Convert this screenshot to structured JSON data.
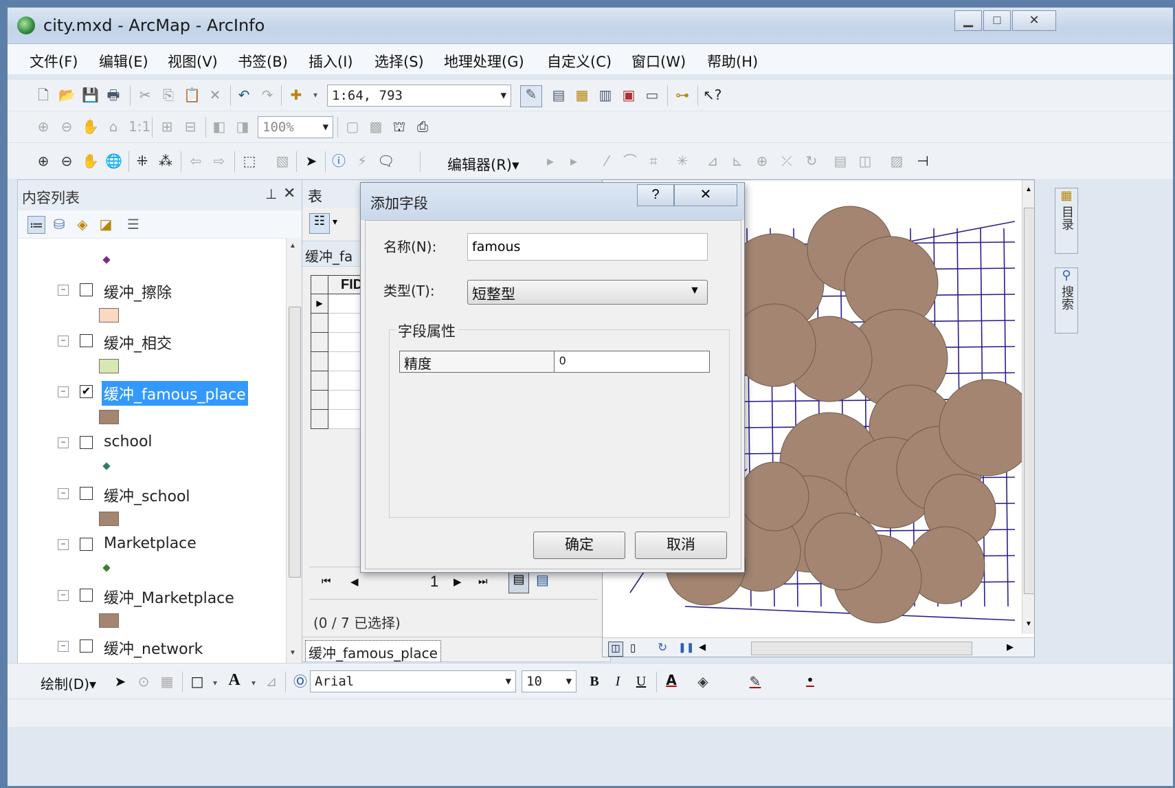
{
  "window": {
    "title": "city.mxd - ArcMap - ArcInfo",
    "minimize": "▭",
    "maximize": "□",
    "close": "✕"
  },
  "menu": [
    "文件(F)",
    "编辑(E)",
    "视图(V)",
    "书签(B)",
    "插入(I)",
    "选择(S)",
    "地理处理(G)",
    "自定义(C)",
    "窗口(W)",
    "帮助(H)"
  ],
  "toolbar": {
    "scale": "1:64, 793",
    "layout_zoom": "100%",
    "editor_label": "编辑器(R)▾"
  },
  "toc": {
    "title": "内容列表",
    "pin": "ᵖ",
    "close": "✕",
    "layers": [
      {
        "name": "缓冲_擦除",
        "checked": false,
        "symbol": "#f9d9c4"
      },
      {
        "name": "缓冲_相交",
        "checked": false,
        "symbol": "#d7e8b5"
      },
      {
        "name": "缓冲_famous_place",
        "checked": true,
        "symbol": "#a48571"
      },
      {
        "name": "school",
        "checked": false,
        "symbol": "#2f7a6b"
      },
      {
        "name": "缓冲_school",
        "checked": false,
        "symbol": "#a48571"
      },
      {
        "name": "Marketplace",
        "checked": false,
        "symbol": "#3c7a35"
      },
      {
        "name": "缓冲_Marketplace",
        "checked": false,
        "symbol": "#a48571"
      },
      {
        "name": "缓冲_network",
        "checked": false,
        "symbol": "#a48571"
      }
    ],
    "top_point_color": "#7b2c7c"
  },
  "table": {
    "title": "表",
    "tab": "缓冲_fa",
    "column": "FID",
    "record": "1",
    "selection": "(0 / 7 已选择)",
    "footer_tab": "缓冲_famous_place"
  },
  "dialog": {
    "title": "添加字段",
    "help": "?",
    "close": "✕",
    "name_label": "名称(N):",
    "name_value": "famous",
    "type_label": "类型(T):",
    "type_value": "短整型",
    "group_label": "字段属性",
    "prop_name": "精度",
    "prop_value": "0",
    "ok": "确定",
    "cancel": "取消"
  },
  "draw_toolbar": {
    "draw_label": "绘制(D)▾",
    "font": "Arial",
    "size": "10",
    "bold": "B",
    "italic": "I",
    "underline": "U"
  },
  "right_dock": {
    "catalog": "目录",
    "search": "搜索"
  },
  "colors": {
    "buffer": "#a48571",
    "roads": "#2a1e8c",
    "selection": "#3399ff"
  }
}
